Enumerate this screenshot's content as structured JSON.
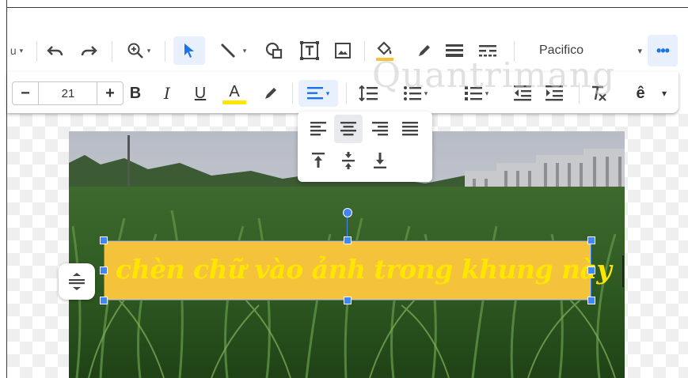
{
  "toolbar": {
    "font_name": "Pacifico",
    "more_label": "•••"
  },
  "text_toolbar": {
    "font_size": "21",
    "minus_label": "−",
    "plus_label": "+",
    "bold_label": "B",
    "italic_label": "I",
    "underline_label": "U",
    "text_color_label": "A",
    "text_color": "#ffe600",
    "caret_label": "ê"
  },
  "watermark": "Quantrimang",
  "textbox": {
    "text": "chèn chữ vào ảnh trong khung này",
    "fill_color": "#f5c33b",
    "text_color": "#ffe600"
  },
  "colors": {
    "accent": "#1a73e8",
    "selection": "#4285f4"
  }
}
